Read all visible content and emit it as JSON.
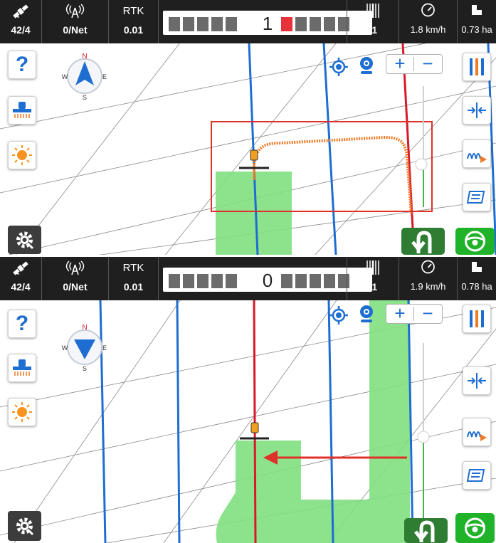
{
  "screens": [
    {
      "status": {
        "satellites": "42/4",
        "network": "0/Net",
        "rtk_label": "RTK",
        "rtk_value": "0.01",
        "offset": "1",
        "line_number": "-1",
        "speed": "1.8 km/h",
        "area": "0.73 ha"
      }
    },
    {
      "status": {
        "satellites": "42/4",
        "network": "0/Net",
        "rtk_label": "RTK",
        "rtk_value": "0.01",
        "offset": "0",
        "line_number": "-1",
        "speed": "1.9 km/h",
        "area": "0.78 ha"
      }
    }
  ],
  "compass": {
    "n": "N",
    "e": "E",
    "s": "S",
    "w": "W"
  },
  "help_glyph": "?",
  "zoom": {
    "plus": "+",
    "minus": "−"
  },
  "icons": {
    "satellite": "satellite-icon",
    "antenna": "antenna-icon",
    "speedometer": "speedometer-icon",
    "area": "area-icon",
    "guidance_line": "guidance-line-icon",
    "implement": "implement-icon",
    "brightness": "brightness-icon",
    "settings": "gear-icon",
    "locate": "locate-icon",
    "camera": "webcam-icon",
    "layers": "layers-icon",
    "width": "width-icon",
    "offset_tool": "offset-tool-icon",
    "path_switch": "path-switch-icon",
    "u_turn": "u-turn-icon",
    "steering": "steering-wheel-icon"
  },
  "colors": {
    "topbar": "#1f1f1f",
    "guide_blue": "#1e6dd1",
    "active_red": "#d7192a",
    "coverage_green": "#7fe07f",
    "path_orange": "#f07a26",
    "highlight_red": "#e0302a",
    "steer_green": "#20b32a"
  }
}
